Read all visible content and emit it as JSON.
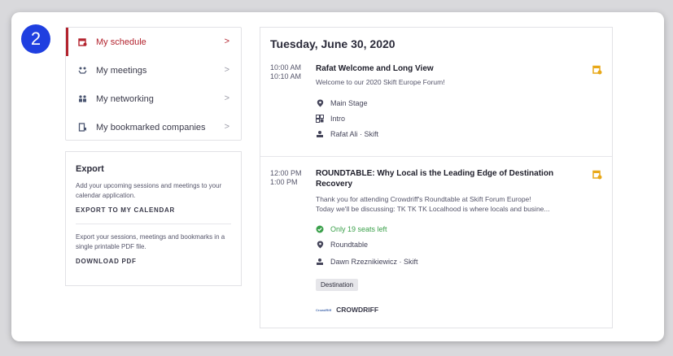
{
  "step_badge": "2",
  "nav": {
    "items": [
      {
        "label": "My schedule",
        "icon": "calendar-icon",
        "active": true
      },
      {
        "label": "My meetings",
        "icon": "meetings-icon",
        "active": false
      },
      {
        "label": "My networking",
        "icon": "people-icon",
        "active": false
      },
      {
        "label": "My bookmarked companies",
        "icon": "bookmark-building-icon",
        "active": false
      }
    ],
    "chevron": ">"
  },
  "export": {
    "title": "Export",
    "calendar_desc": "Add your upcoming sessions and meetings to your calendar application.",
    "calendar_link": "EXPORT TO MY CALENDAR",
    "pdf_desc": "Export your sessions, meetings and bookmarks in a single printable PDF file.",
    "pdf_link": "DOWNLOAD PDF"
  },
  "schedule": {
    "date": "Tuesday, June 30, 2020",
    "sessions": [
      {
        "start": "10:00 AM",
        "end": "10:10 AM",
        "title": "Rafat Welcome and Long View",
        "description": "Welcome to our 2020 Skift Europe Forum!",
        "location": "Main Stage",
        "format": "Intro",
        "speaker": "Rafat Ali · Skift"
      },
      {
        "start": "12:00 PM",
        "end": "1:00 PM",
        "title": "ROUNDTABLE: Why Local is the Leading Edge of Destination Recovery",
        "description_line1": "Thank you for attending Crowdriff's Roundtable at Skift Forum Europe!",
        "description_line2": "Today we'll be discussing:   TK TK TK  Localhood is where locals and busine...",
        "seats": "Only 19 seats left",
        "location": "Roundtable",
        "speaker": "Dawn Rzeznikiewicz · Skift",
        "tag": "Destination",
        "sponsor_logo": "CrowdRiff",
        "sponsor": "CROWDRIFF"
      }
    ]
  },
  "colors": {
    "accent": "#b3232e",
    "badge": "#1f3fe0",
    "bookmark": "#e8a818",
    "seats": "#3aa04a"
  }
}
